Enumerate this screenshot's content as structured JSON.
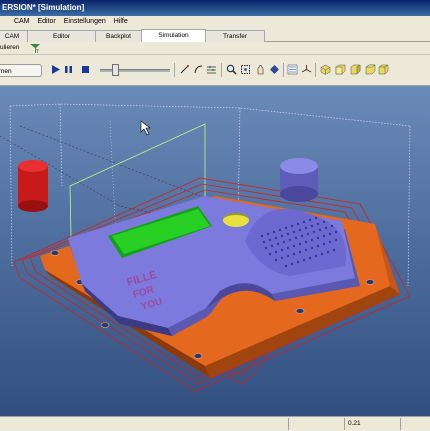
{
  "window": {
    "title": "ERSION*  [Simulation]"
  },
  "menu": [
    "CAM",
    "Editor",
    "Einstellungen",
    "Hilfe"
  ],
  "tabs": [
    {
      "label": "CAM",
      "active": false
    },
    {
      "label": "Editor",
      "active": false
    },
    {
      "label": "Backplot",
      "active": false
    },
    {
      "label": "Simulation",
      "active": true
    },
    {
      "label": "Transfer",
      "active": false
    }
  ],
  "toolbar1": {
    "label": "ulieren"
  },
  "toolbar2": {
    "start_label": "men"
  },
  "status": {
    "value": "0.21"
  },
  "part": {
    "engraving": [
      "FILLE",
      "FOR",
      "YOU"
    ]
  },
  "colors": {
    "plate": "#e0671e",
    "block": "#7a78dc",
    "pocket": "#22c81e",
    "yellow_hole": "#e8e040",
    "red_cylinder": "#cc1818",
    "toolpath": "#d02020"
  },
  "icons": [
    "play-icon",
    "pause-icon",
    "stop-icon",
    "draw-icon",
    "curve-icon",
    "settings-icon",
    "zoom-icon",
    "zoom-window-icon",
    "pan-icon",
    "rotate-icon",
    "measure-icon",
    "axis-icon",
    "cube-icon",
    "cube-front-icon",
    "cube-side-icon",
    "cube-top-icon",
    "cube-iso-icon"
  ]
}
